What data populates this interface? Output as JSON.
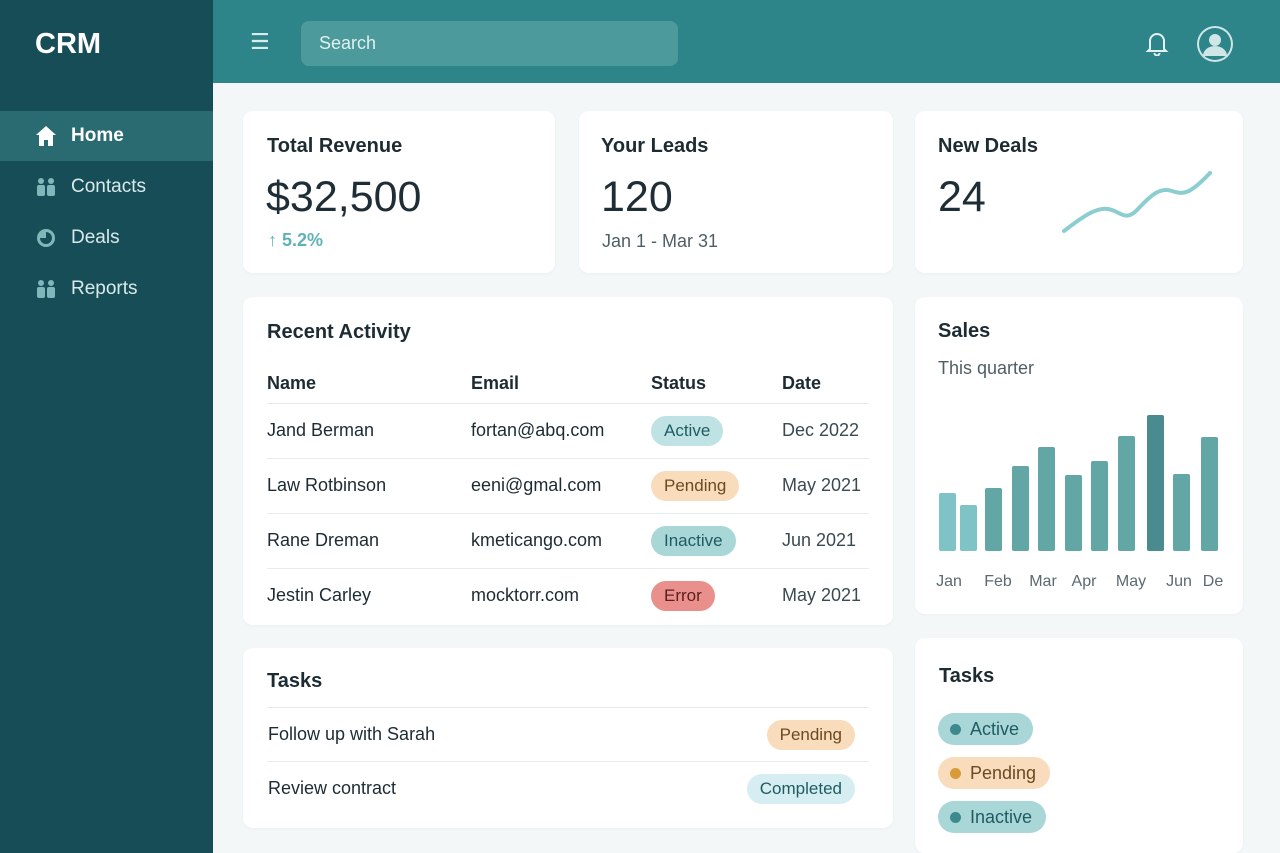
{
  "app": {
    "title": "CRM"
  },
  "sidebar": {
    "items": [
      {
        "label": "Home",
        "icon": "home-icon",
        "active": true
      },
      {
        "label": "Contacts",
        "icon": "users-icon"
      },
      {
        "label": "Deals",
        "icon": "pie-icon"
      },
      {
        "label": "Reports",
        "icon": "users-icon"
      }
    ]
  },
  "topbar": {
    "search_placeholder": "Search",
    "icons": [
      "menu-icon",
      "bell-icon",
      "avatar-icon"
    ]
  },
  "stats": {
    "revenue": {
      "title": "Total Revenue",
      "value": "$32,500",
      "change": "5.2%"
    },
    "leads": {
      "title": "Your Leads",
      "value": "120",
      "range": "Jan 1 - Mar 31"
    },
    "deals": {
      "title": "New Deals",
      "value": "24"
    }
  },
  "activity": {
    "title": "Recent Activity",
    "columns": [
      "Name",
      "Email",
      "Status",
      "Date"
    ],
    "rows": [
      {
        "name": "Jand Berman",
        "email": "fortan@abq.com",
        "status": "Active",
        "date": "Dec 2022"
      },
      {
        "name": "Law Rotbinson",
        "email": "eeni@gmal.com",
        "status": "Pending",
        "date": "May 2021"
      },
      {
        "name": "Rane Dreman",
        "email": "kmeticango.com",
        "status": "Inactive",
        "date": "Jun 2021"
      },
      {
        "name": "Jestin Carley",
        "email": "mocktorr.com",
        "status": "Error",
        "date": "May 2021"
      }
    ]
  },
  "tasks": {
    "title": "Tasks",
    "items": [
      {
        "label": "Follow up with Sarah",
        "status": "Pending"
      },
      {
        "label": "Review contract",
        "status": "Completed"
      }
    ]
  },
  "task_legend": {
    "title": "Tasks",
    "items": [
      {
        "label": "Active",
        "color": "#3d8a8e"
      },
      {
        "label": "Pending",
        "color": "#d99a3a"
      },
      {
        "label": "Inactive",
        "color": "#3d8a8e"
      }
    ]
  },
  "colors": {
    "sidebar": "#174d57",
    "topbar": "#2e8589",
    "accent": "#5fb3b8"
  },
  "chart_data": {
    "type": "bar",
    "title": "Sales",
    "subtitle": "This quarter",
    "tick_labels": [
      "Jan",
      "Feb",
      "Mar",
      "Apr",
      "May",
      "Jun",
      "De"
    ],
    "values": [
      58,
      46,
      63,
      85,
      104,
      76,
      90,
      115,
      136,
      77,
      114
    ],
    "highlight_index": 8,
    "grid": false
  }
}
